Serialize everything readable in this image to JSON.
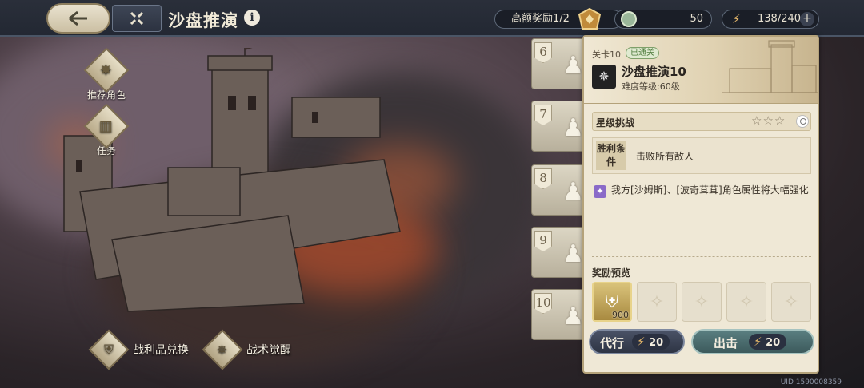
{
  "header": {
    "title": "沙盘推演",
    "info_icon": "i",
    "reward_label": "高额奖励1/2",
    "gems": "50",
    "stamina": "138/240",
    "plus": "+"
  },
  "sidebar": {
    "recommend_label": "推荐角色",
    "quest_label": "任务"
  },
  "stages": [
    "6",
    "7",
    "8",
    "9",
    "10"
  ],
  "panel": {
    "level_label": "关卡10",
    "cleared_badge": "已通关",
    "level_name": "沙盘推演10",
    "difficulty": "难度等级:60级",
    "star_challenge": "星级挑战",
    "stars": "☆☆☆",
    "win_condition_label": "胜利条件",
    "win_condition_text": "击败所有敌人",
    "buff_text": "我方[沙姆斯]、[波奇茸茸]角色属性将大幅强化",
    "reward_title": "奖励预览",
    "reward_count": "900",
    "delegate_label": "代行",
    "delegate_cost": "20",
    "battle_label": "出击",
    "battle_cost": "20"
  },
  "bottom": {
    "loot_exchange": "战利品兑换",
    "tactic_awaken": "战术觉醒"
  },
  "uid": "UID 1590008359",
  "colors": {
    "accent_gold": "#e6b86a",
    "panel_bg": "#efe8d6",
    "battle_button": "#4f7072"
  }
}
